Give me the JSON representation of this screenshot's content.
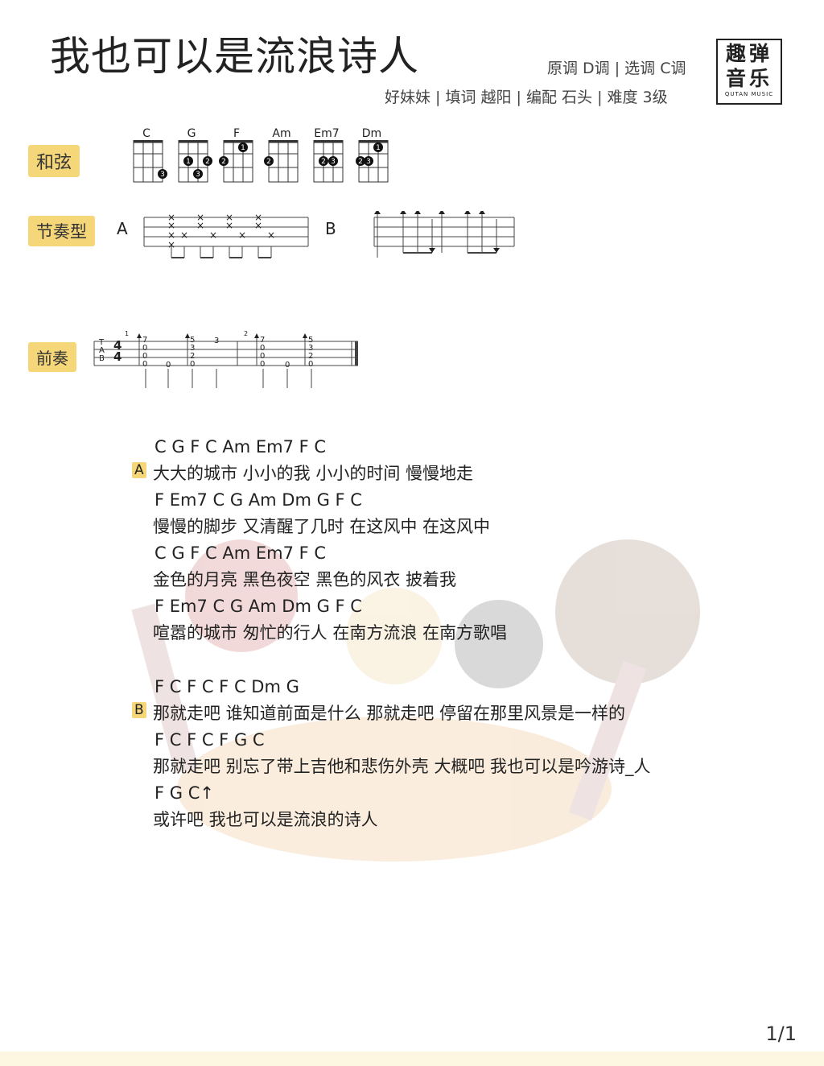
{
  "title": "我也可以是流浪诗人",
  "key_info": "原调 D调 | 选调 C调",
  "credits": "好妹妹 | 填词  越阳 | 编配  石头 | 难度 3级",
  "logo": {
    "line1": "趣弹",
    "line2": "音乐",
    "sub": "QUTAN MUSIC"
  },
  "labels": {
    "chords": "和弦",
    "rhythm": "节奏型",
    "intro": "前奏"
  },
  "chord_names": [
    "C",
    "G",
    "F",
    "Am",
    "Em7",
    "Dm"
  ],
  "rhythm": {
    "a": "A",
    "b": "B"
  },
  "sections": {
    "a": "A",
    "b": "B"
  },
  "tab": {
    "strings": [
      "T",
      "A",
      "B"
    ],
    "time_sig": [
      "4",
      "4"
    ],
    "measures": [
      "1",
      "2"
    ],
    "fret_col1": [
      "7",
      "0",
      "0",
      "0"
    ],
    "fret_col2": [
      "0"
    ],
    "fret_col3": [
      "5",
      "3",
      "2",
      "0"
    ],
    "fret_col4": [
      "3"
    ],
    "fret_col5": [
      "7",
      "0",
      "0",
      "0"
    ],
    "fret_col6": [
      "0"
    ],
    "fret_col7": [
      "5",
      "3",
      "2",
      "0"
    ]
  },
  "lines": [
    {
      "chords": "C        G   F      C      Am    Em7   F      C",
      "lyrics": "大大的城市  小小的我   小小的时间  慢慢地走"
    },
    {
      "chords": " F     Em7      C   G   Am   Dm     G    F      C",
      "lyrics": "慢慢的脚步  又清醒了几时    在这风中  在这风中"
    },
    {
      "chords": "C        G   F      C      Am    Em7   F    C",
      "lyrics": "金色的月亮  黑色夜空   黑色的风衣  披着我"
    },
    {
      "chords": " F     Em7   C   G    Am     Dm      G     F      C",
      "lyrics": "喧嚣的城市  匆忙的行人   在南方流浪  在南方歌唱"
    },
    {
      "chords": "F    C      F          C      F    C        Dm          G",
      "lyrics": "那就走吧  谁知道前面是什么    那就走吧  停留在那里风景是一样的"
    },
    {
      "chords": "F    C          F         C         F           G         C",
      "lyrics": "那就走吧 别忘了带上吉他和悲伤外壳   大概吧  我也可以是吟游诗_人"
    },
    {
      "chords": "F           G            C↑",
      "lyrics": "或许吧   我也可以是流浪的诗人"
    }
  ],
  "page": "1/1",
  "colors": {
    "accent": "#f5d77a",
    "ink": "#222222"
  }
}
